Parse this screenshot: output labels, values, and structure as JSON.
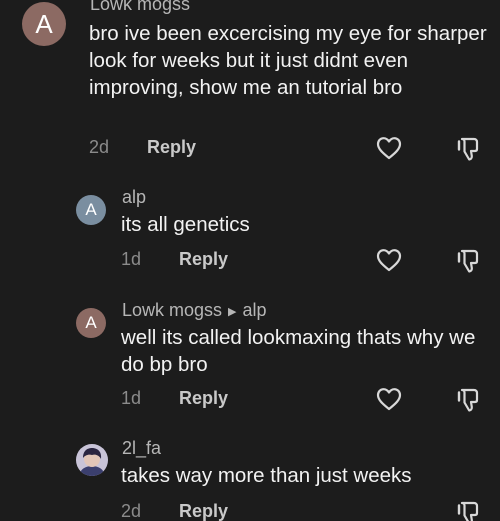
{
  "comments": [
    {
      "avatar_letter": "A",
      "username": "Lowk mogss",
      "text": "bro ive been excercising my eye for sharper look for weeks but it just didnt even improving, show me an tutorial bro",
      "time": "2d",
      "reply_label": "Reply"
    }
  ],
  "replies": [
    {
      "avatar_letter": "A",
      "username": "alp",
      "text": "its all genetics",
      "time": "1d",
      "reply_label": "Reply"
    },
    {
      "avatar_letter": "A",
      "username": "Lowk mogss",
      "reply_to": "alp",
      "text": "well its called lookmaxing thats why we do bp bro",
      "time": "1d",
      "reply_label": "Reply"
    },
    {
      "username": "2l_fa",
      "text": "takes way more than just weeks",
      "time": "2d",
      "reply_label": "Reply"
    }
  ],
  "icons": {
    "like": "heart-icon",
    "dislike": "thumbs-down-icon",
    "reply_arrow": "right-triangle-icon"
  },
  "colors": {
    "background": "#1c1c1c",
    "username": "#b6b6b6",
    "text": "#f2f2f2",
    "timestamp": "#8b8b8b",
    "avatar_a": "#8c6a63",
    "avatar_alp": "#7a8ea0"
  }
}
